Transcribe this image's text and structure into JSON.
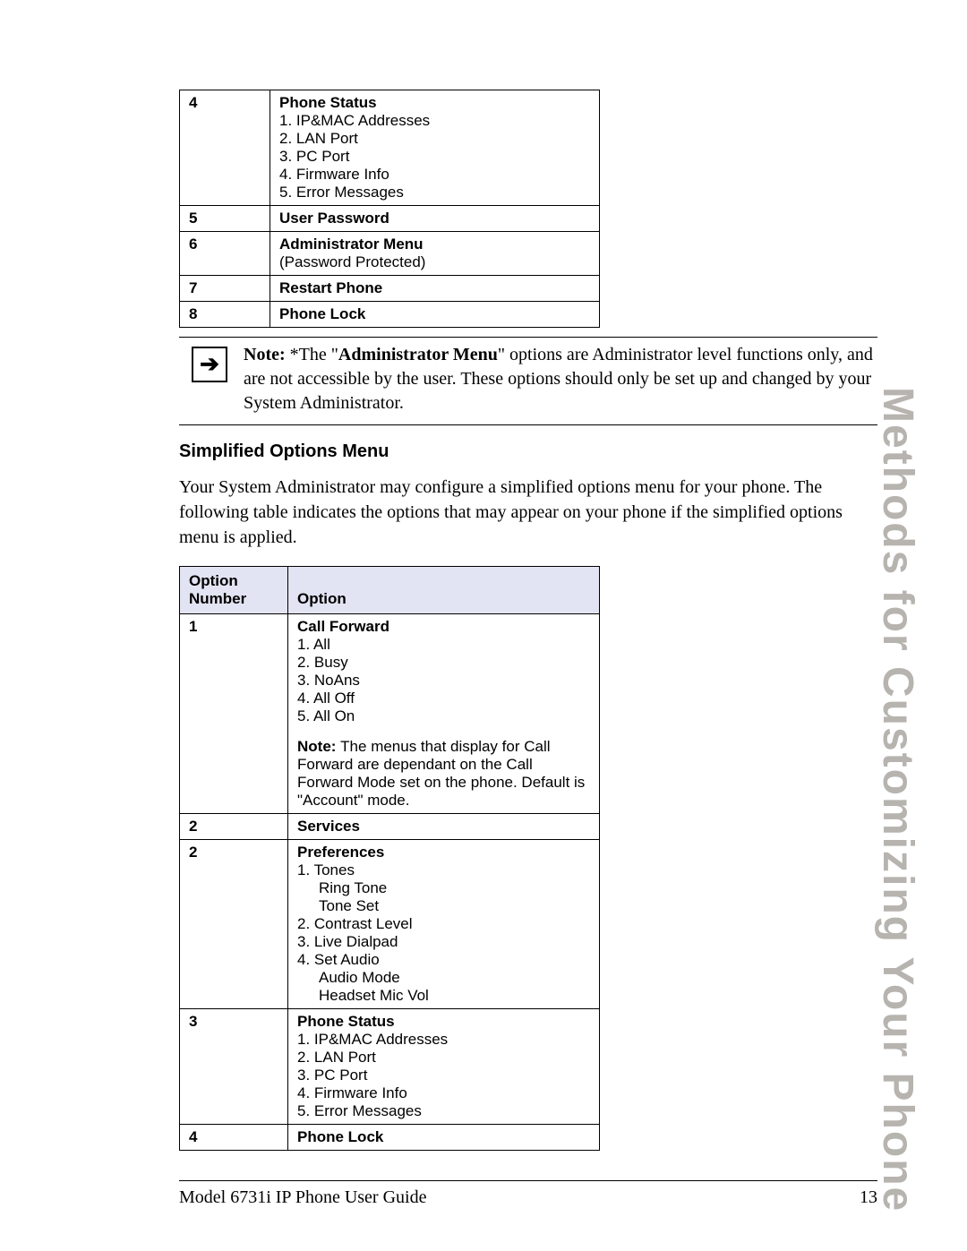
{
  "side_label": "Methods for Customizing Your Phone",
  "table1": {
    "rows": [
      {
        "num": "4",
        "title": "Phone Status",
        "items": [
          "1. IP&MAC Addresses",
          "2. LAN Port",
          "3. PC Port",
          "4. Firmware Info",
          "5. Error Messages"
        ]
      },
      {
        "num": "5",
        "title": "User Password"
      },
      {
        "num": "6",
        "title": "Administrator Menu",
        "extra": "(Password Protected)"
      },
      {
        "num": "7",
        "title": "Restart Phone"
      },
      {
        "num": "8",
        "title": "Phone Lock"
      }
    ]
  },
  "note": {
    "bold_lead": "Note: ",
    "pre": "*The \"",
    "admin_menu": "Administrator Menu",
    "post": "\" options are Administrator level functions only, and are not accessible by the user. These options should only be set up and changed by your System Administrator."
  },
  "section_heading": "Simplified Options Menu",
  "section_body": "Your System Administrator may configure a simplified options menu for your phone. The following table indicates the options that may appear on your phone if the simplified options menu is applied.",
  "table2": {
    "head_col1_l1": "Option",
    "head_col1_l2": "Number",
    "head_col2": "Option",
    "rows": [
      {
        "num": "1",
        "title": "Call Forward",
        "items": [
          "1. All",
          "2. Busy",
          "3. NoAns",
          "4. All Off",
          "5. All On"
        ],
        "note_bold": "Note: ",
        "note_rest": "The menus that display for Call Forward are dependant on the Call Forward Mode set on the phone. Default is \"Account\" mode."
      },
      {
        "num": "2",
        "title": "Services"
      },
      {
        "num": "2",
        "title": "Preferences",
        "lines": [
          "1. Tones",
          {
            "sub": "Ring Tone"
          },
          {
            "sub": "Tone Set"
          },
          "2. Contrast Level",
          "3. Live Dialpad",
          "4. Set Audio",
          {
            "sub": "Audio Mode"
          },
          {
            "sub": "Headset Mic Vol"
          }
        ]
      },
      {
        "num": "3",
        "title": "Phone Status",
        "items": [
          "1. IP&MAC Addresses",
          "2. LAN Port",
          "3. PC Port",
          "4. Firmware Info",
          "5. Error Messages"
        ]
      },
      {
        "num": "4",
        "title": "Phone Lock"
      }
    ]
  },
  "footer_left": "Model 6731i IP Phone User Guide",
  "footer_right": "13"
}
